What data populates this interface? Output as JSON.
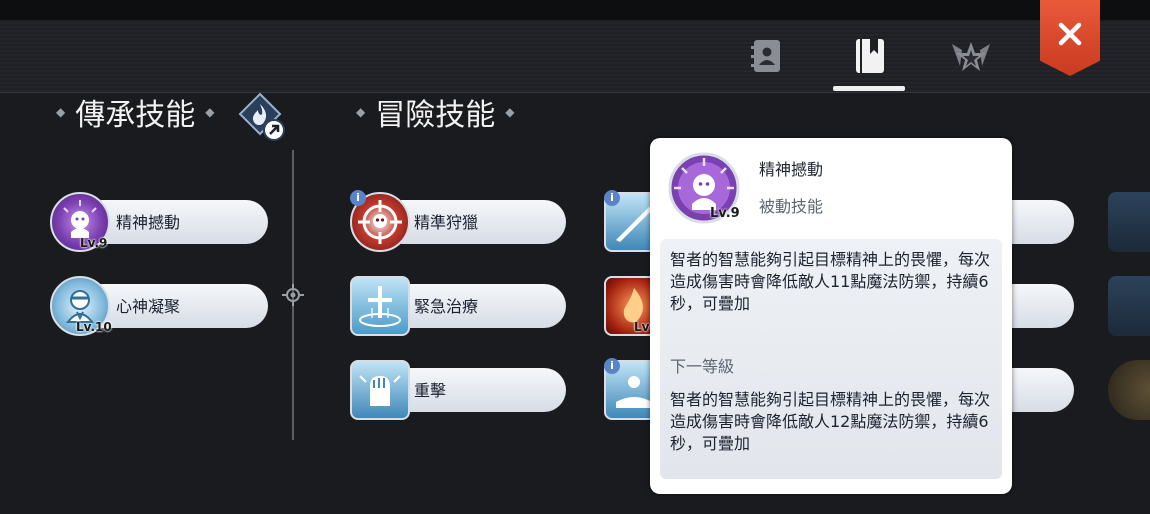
{
  "header": {
    "tabs": [
      {
        "icon": "contact-book-icon",
        "active": false
      },
      {
        "icon": "skill-book-icon",
        "active": true
      },
      {
        "icon": "winged-star-icon",
        "active": false
      }
    ],
    "close_icon": "close-x-icon"
  },
  "sections": {
    "inherited_title": "傳承技能",
    "adventure_title": "冒險技能"
  },
  "inherited_skills": [
    {
      "name": "精神撼動",
      "level": "Lv.9",
      "icon": "spirit-shock-icon"
    },
    {
      "name": "心神凝聚",
      "level": "Lv.10",
      "icon": "mind-focus-icon"
    }
  ],
  "adventure_skills": [
    {
      "name": "精準狩獵",
      "icon": "precision-hunt-icon",
      "info": "i"
    },
    {
      "name": "緊急治療",
      "icon": "emergency-heal-icon"
    },
    {
      "name": "重擊",
      "icon": "heavy-strike-icon"
    }
  ],
  "partial_col": [
    {
      "info": "i",
      "level": ""
    },
    {
      "info": "",
      "level": "Lv"
    },
    {
      "info": "i",
      "level": ""
    }
  ],
  "tooltip": {
    "name": "精神撼動",
    "type": "被動技能",
    "level": "Lv.9",
    "current_desc": "智者的智慧能夠引起目標精神上的畏懼，每次造成傷害時會降低敵人11點魔法防禦，持續6秒，可疊加",
    "next_label": "下一等級",
    "next_desc": "智者的智慧能夠引起目標精神上的畏懼，每次造成傷害時會降低敵人12點魔法防禦，持續6秒，可疊加"
  },
  "colors": {
    "background": "#1a1b1f",
    "close_button": "#d9472a",
    "skill_bar": "#e8ecf2",
    "purple_icon": "#7a3fb0"
  }
}
